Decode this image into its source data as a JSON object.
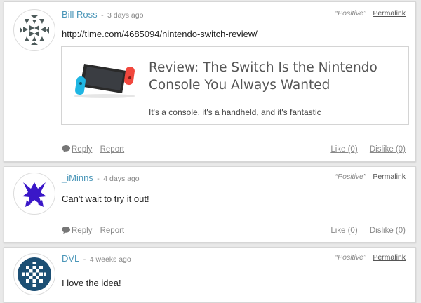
{
  "comments": [
    {
      "author": "Bill Ross",
      "separator": "-",
      "time": "3 days ago",
      "sentiment": "“Positive”",
      "permalink": "Permalink",
      "text": "http://time.com/4685094/nintendo-switch-review/",
      "preview": {
        "title": "Review: The Switch Is the Nintendo Console You Always Wanted",
        "description": "It's a console, it's a handheld, and it's fantastic"
      },
      "reply": "Reply",
      "report": "Report",
      "like": "Like (0)",
      "dislike": "Dislike (0)",
      "avatar_color": "#4d5a5a"
    },
    {
      "author": "_iMinns",
      "separator": "-",
      "time": "4 days ago",
      "sentiment": "“Positive”",
      "permalink": "Permalink",
      "text": "Can't wait to try it out!",
      "reply": "Reply",
      "report": "Report",
      "like": "Like (0)",
      "dislike": "Dislike (0)",
      "avatar_color": "#3a17c8"
    },
    {
      "author": "DVL",
      "separator": "-",
      "time": "4 weeks ago",
      "sentiment": "“Positive”",
      "permalink": "Permalink",
      "text": "I love the idea!",
      "avatar_color": "#1c4f74"
    }
  ],
  "colors": {
    "author_link": "#4a96b8",
    "muted": "#888888",
    "background": "#e9e9e9"
  },
  "icons": {
    "reply": "speech-bubble-icon"
  }
}
